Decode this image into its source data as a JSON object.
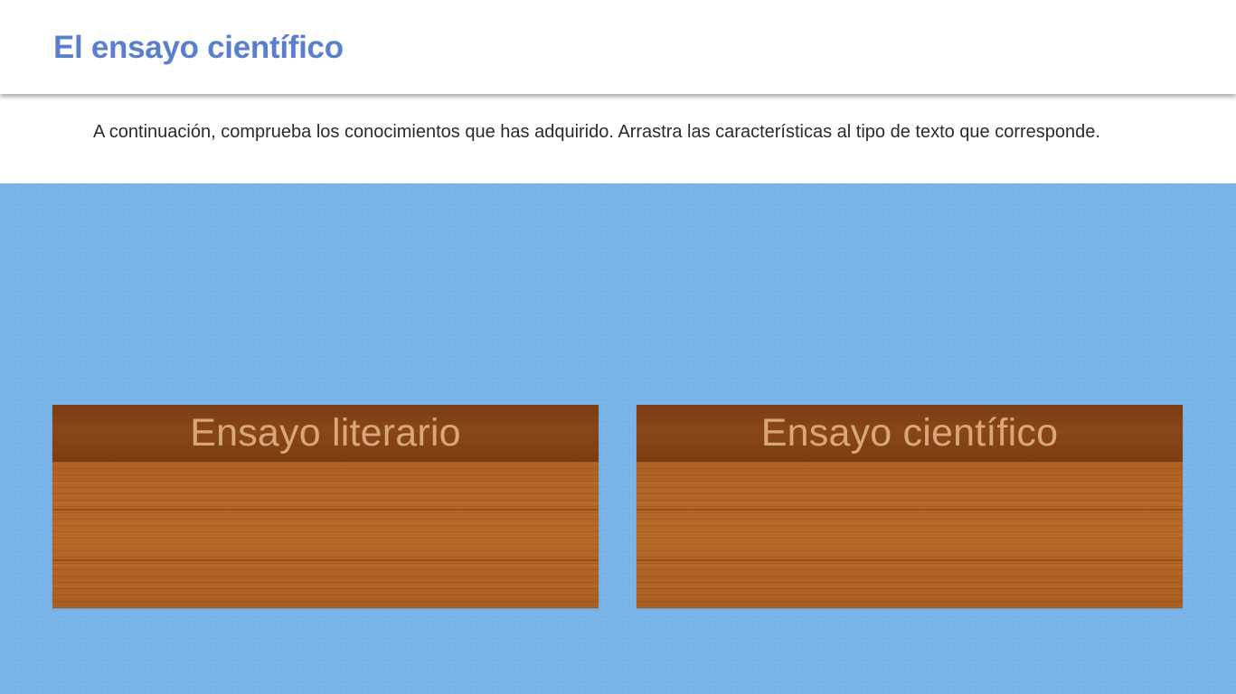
{
  "header": {
    "title": "El ensayo científico"
  },
  "instructions": {
    "text": "A continuación, comprueba los conocimientos que has adquirido. Arrastra las características al tipo de texto que corresponde."
  },
  "drop_zones": [
    {
      "label": "Ensayo literario"
    },
    {
      "label": "Ensayo científico"
    }
  ],
  "colors": {
    "title": "#5b7fcf",
    "background": "#78b4e8",
    "wood_header": "#7d3e12",
    "wood_body": "#b06526",
    "zone_label": "#d7a77a"
  }
}
